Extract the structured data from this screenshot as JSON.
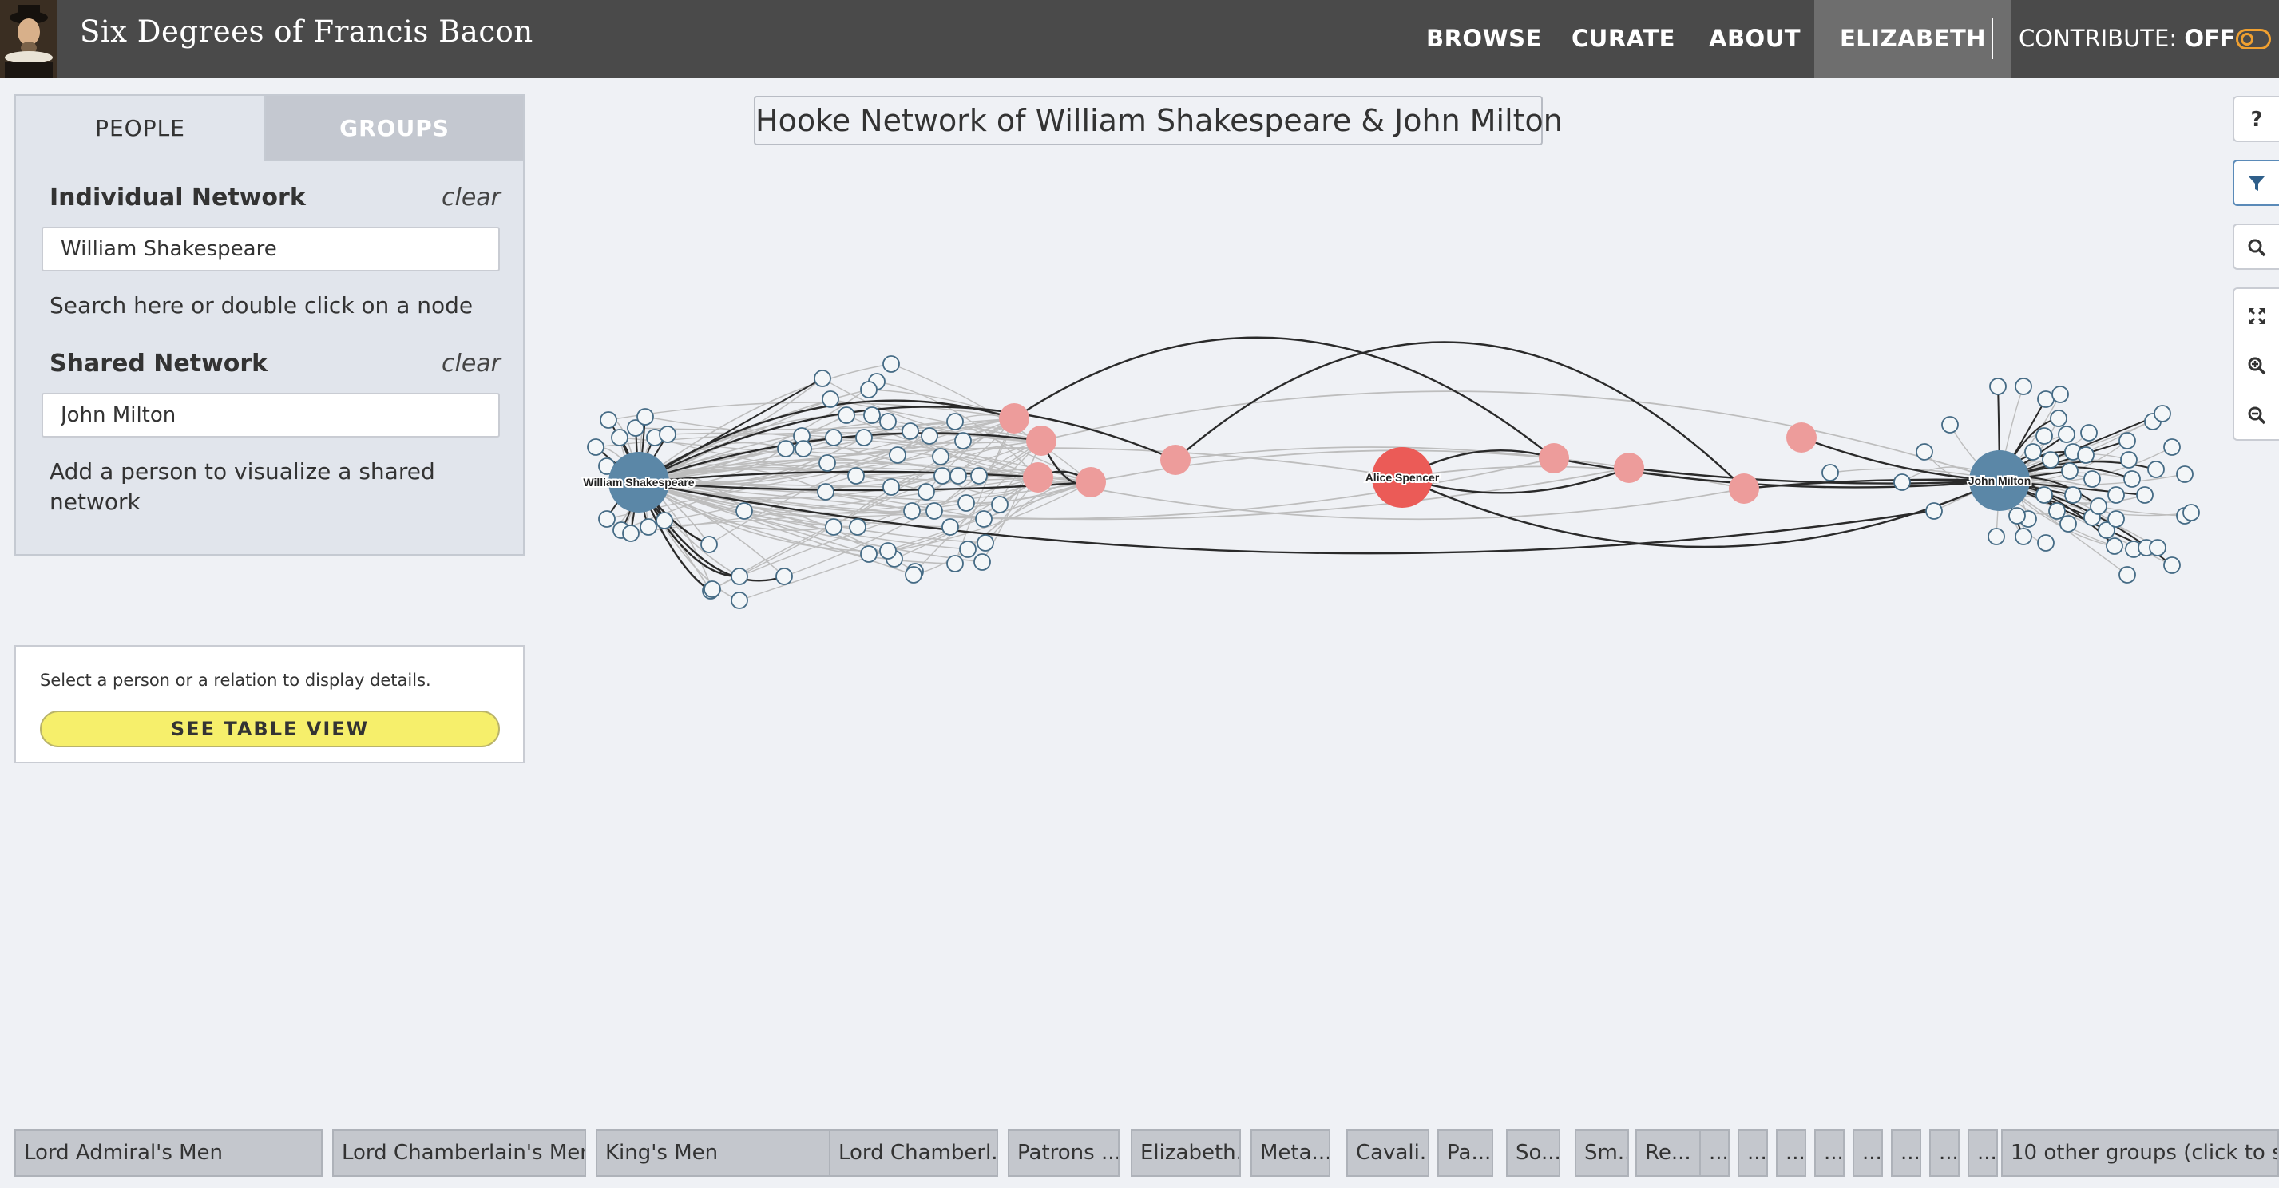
{
  "header": {
    "site_title": "Six Degrees of Francis Bacon",
    "nav": [
      "BROWSE",
      "CURATE",
      "ABOUT"
    ],
    "user": "ELIZABETH",
    "contribute_label": "CONTRIBUTE:",
    "contribute_state": "OFF"
  },
  "panel": {
    "tabs": {
      "people": "PEOPLE",
      "groups": "GROUPS"
    },
    "individual_label": "Individual Network",
    "individual_clear": "clear",
    "individual_value": "William Shakespeare",
    "individual_help": "Search here or double click on a node",
    "shared_label": "Shared Network",
    "shared_clear": "clear",
    "shared_value": "John Milton",
    "shared_help": "Add a person to visualize a shared network"
  },
  "details": {
    "prompt": "Select a person or a relation to display details.",
    "table_button": "SEE TABLE VIEW"
  },
  "graph": {
    "title": "Hooke Network of William Shakespeare & John Milton",
    "labeled_nodes": [
      "William Shakespeare",
      "Alice Spencer",
      "John Milton"
    ],
    "colors": {
      "primary": "#5b87a7",
      "bridge": "#eb5b57",
      "intermediate": "#ed9c9b",
      "peripheral": "#f3f6f8",
      "edge_strong": "#2a2a2a",
      "edge_weak": "#bdbdbd"
    }
  },
  "tools": {
    "help": "?",
    "icons": [
      "filter-icon",
      "search-icon",
      "fit-screen-icon",
      "zoom-in-icon",
      "zoom-out-icon"
    ]
  },
  "groups": [
    "Lord Admiral's Men",
    "Lord Chamberlain's Men",
    "King's Men",
    "Lord Chamberl...",
    "Patrons ...",
    "Elizabeth...",
    "Meta...",
    "Cavali...",
    "Pa...",
    "So...",
    "Sm...",
    "Re...",
    "...",
    "...",
    "...",
    "...",
    "...",
    "...",
    "...",
    "...",
    "10 other groups (click to s..."
  ]
}
